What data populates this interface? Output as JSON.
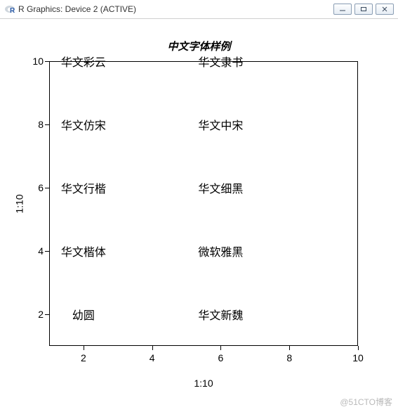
{
  "window": {
    "title": "R Graphics: Device 2 (ACTIVE)",
    "icon_name": "r-logo-icon"
  },
  "chart_data": {
    "type": "scatter",
    "title": "中文字体样例",
    "xlabel": "1:10",
    "ylabel": "1:10",
    "xlim": [
      1,
      10
    ],
    "ylim": [
      1,
      10
    ],
    "xticks": [
      2,
      4,
      6,
      8,
      10
    ],
    "yticks": [
      2,
      4,
      6,
      8,
      10
    ],
    "points": [
      {
        "x": 2,
        "y": 10,
        "label": "华文彩云",
        "font": "STCaiyun"
      },
      {
        "x": 2,
        "y": 8,
        "label": "华文仿宋",
        "font": "STFangsong"
      },
      {
        "x": 2,
        "y": 6,
        "label": "华文行楷",
        "font": "STXingkai"
      },
      {
        "x": 2,
        "y": 4,
        "label": "华文楷体",
        "font": "STKaiti"
      },
      {
        "x": 2,
        "y": 2,
        "label": "幼圆",
        "font": "YouYuan"
      },
      {
        "x": 6,
        "y": 10,
        "label": "华文隶书",
        "font": "STLiti"
      },
      {
        "x": 6,
        "y": 8,
        "label": "华文中宋",
        "font": "STZhongsong"
      },
      {
        "x": 6,
        "y": 6,
        "label": "华文细黑",
        "font": "STXihei"
      },
      {
        "x": 6,
        "y": 4,
        "label": "微软雅黑",
        "font": "Microsoft YaHei"
      },
      {
        "x": 6,
        "y": 2,
        "label": "华文新魏",
        "font": "STXinwei"
      }
    ]
  },
  "watermark": "@51CTO博客"
}
